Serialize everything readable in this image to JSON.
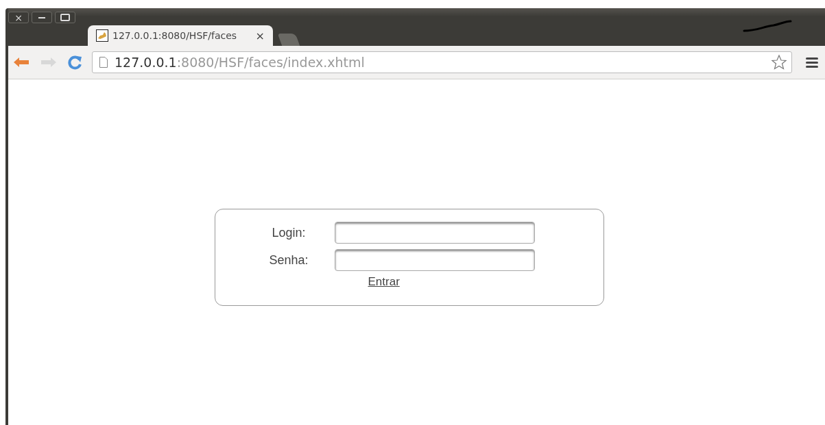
{
  "window": {
    "controls": [
      "×"
    ]
  },
  "tab": {
    "title": "127.0.0.1:8080/HSF/faces",
    "close": "×"
  },
  "address_bar": {
    "host": "127.0.0.1",
    "path": ":8080/HSF/faces/index.xhtml"
  },
  "form": {
    "fields": [
      {
        "label": "Login:"
      },
      {
        "label": "Senha:"
      }
    ],
    "submit": "Entrar"
  }
}
